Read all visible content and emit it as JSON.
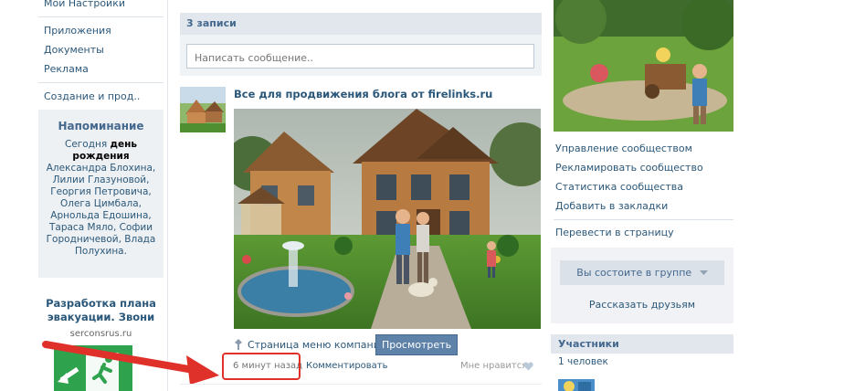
{
  "left_menu": {
    "items": [
      "Мои Настройки",
      "Приложения",
      "Документы",
      "Реклама",
      "Создание и прод.."
    ]
  },
  "reminder": {
    "title": "Напоминание",
    "today": "Сегодня",
    "bold_text": "день рождения",
    "names": "Александра Блохина, Лилии Глазуновой, Георгия Петровича, Олега Цимбала, Арнольда Едошина, Тараса Мяло, Софии Городничевой, Влада Полухина."
  },
  "ad": {
    "title": "Разработка плана эвакуации. Звони",
    "domain": "serconsrus.ru"
  },
  "wall": {
    "header": "3 записи",
    "input_placeholder": "Написать сообщение.."
  },
  "post": {
    "title": "Все для продвижения блога от firelinks.ru",
    "link_text": "Страница меню компании",
    "view_button": "Просмотреть",
    "time": "6 минут назад",
    "comment": "Комментировать",
    "like": "Мне нравится"
  },
  "right": {
    "links": [
      "Управление сообществом",
      "Рекламировать сообщество",
      "Статистика сообщества",
      "Добавить в закладки"
    ],
    "translate": "Перевести в страницу",
    "member_button": "Вы состоите в группе",
    "tell_friends": "Рассказать друзьям",
    "members_header": "Участники",
    "members_count": "1 человек"
  },
  "colors": {
    "link": "#2b587a",
    "header_bg": "#e1e7ed",
    "button": "#5e82a8",
    "highlight": "#e0302a"
  }
}
